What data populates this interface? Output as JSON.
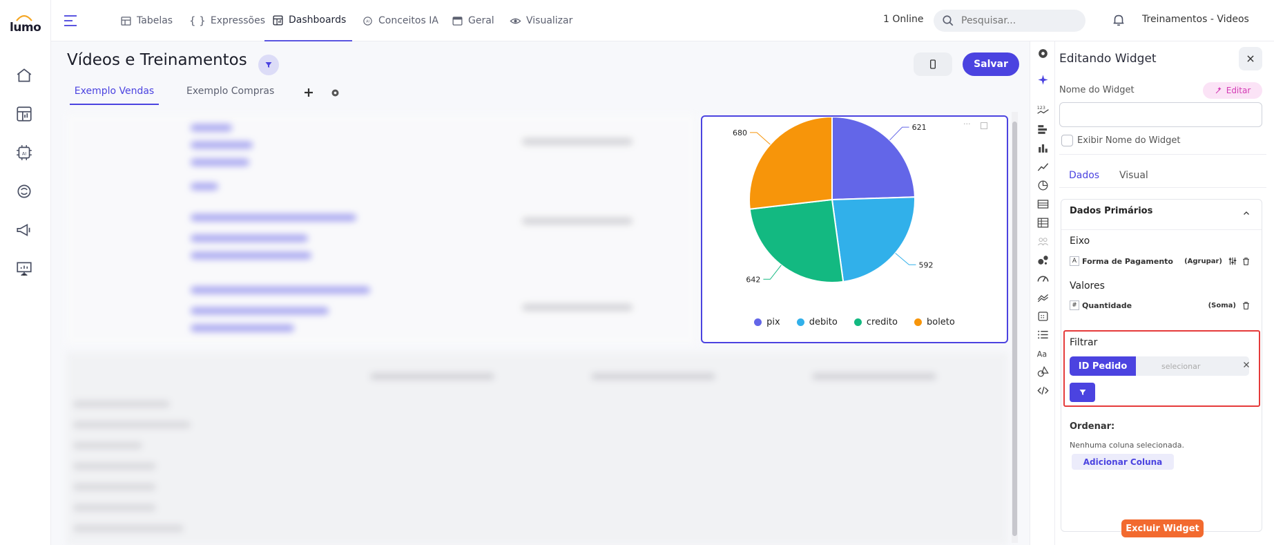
{
  "app": {
    "logo": "lumo"
  },
  "nav": {
    "items": [
      {
        "label": "Tabelas",
        "icon": "table-icon"
      },
      {
        "label": "Expressões",
        "icon": "braces-icon"
      },
      {
        "label": "Dashboards",
        "icon": "dashboard-icon",
        "active": true
      },
      {
        "label": "Conceitos IA",
        "icon": "ai-icon"
      },
      {
        "label": "Geral",
        "icon": "window-icon"
      },
      {
        "label": "Visualizar",
        "icon": "eye-icon"
      }
    ],
    "online": "1 Online",
    "search_placeholder": "Pesquisar...",
    "workspace": "Treinamentos - Videos"
  },
  "dashboard": {
    "title": "Vídeos e Treinamentos",
    "save_label": "Salvar",
    "tabs": [
      {
        "label": "Exemplo Vendas",
        "active": true
      },
      {
        "label": "Exemplo Compras"
      }
    ]
  },
  "chart_data": {
    "type": "pie",
    "slices": [
      {
        "name": "pix",
        "value": 621,
        "color": "#6366e8"
      },
      {
        "name": "debito",
        "value": 592,
        "color": "#31b0ea"
      },
      {
        "name": "credito",
        "value": 642,
        "color": "#13b981"
      },
      {
        "name": "boleto",
        "value": 680,
        "color": "#f7950a"
      }
    ],
    "legend": "bottom"
  },
  "panel": {
    "title": "Editando Widget",
    "widget_name_label": "Nome do Widget",
    "edit_label": "Editar",
    "widget_name_value": "",
    "show_name_label": "Exibir Nome do Widget",
    "tabs": [
      {
        "label": "Dados",
        "active": true
      },
      {
        "label": "Visual"
      }
    ],
    "primary_section": "Dados Primários",
    "axis_label": "Eixo",
    "axis_field": {
      "type": "A",
      "name": "Forma de Pagamento",
      "agg": "(Agrupar)"
    },
    "values_label": "Valores",
    "values_field": {
      "type": "#",
      "name": "Quantidade",
      "agg": "(Soma)"
    },
    "filter_label": "Filtrar",
    "filter_field": "ID Pedido",
    "filter_select": "selecionar",
    "order_label": "Ordenar:",
    "order_empty": "Nenhuma coluna selecionada.",
    "add_column": "Adicionar Coluna",
    "delete_label": "Excluir Widget"
  },
  "colors": {
    "accent": "#4b43e0",
    "highlight": "#e53a3a",
    "danger": "#f26a2f"
  }
}
